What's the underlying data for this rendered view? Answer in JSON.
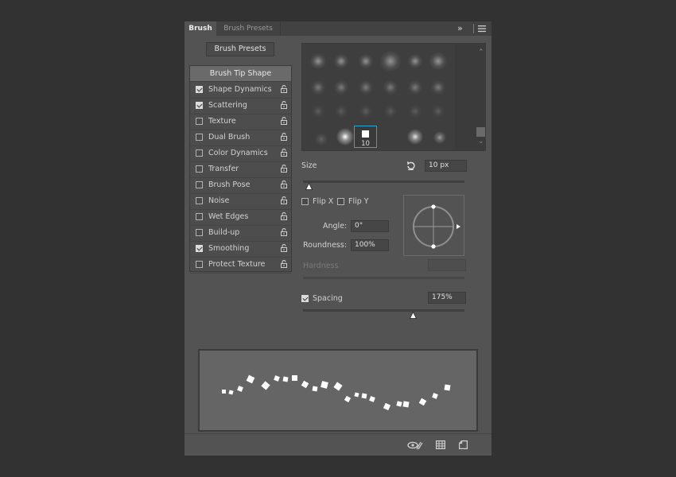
{
  "tabs": {
    "active": "Brush",
    "inactive": "Brush Presets"
  },
  "header_icons": {
    "expand": "double-chevron-right-icon",
    "menu": "hamburger-menu-icon"
  },
  "presets_button": "Brush Presets",
  "options": {
    "header": "Brush Tip Shape",
    "items": [
      {
        "label": "Shape Dynamics",
        "checked": true
      },
      {
        "label": "Scattering",
        "checked": true
      },
      {
        "label": "Texture",
        "checked": false
      },
      {
        "label": "Dual Brush",
        "checked": false
      },
      {
        "label": "Color Dynamics",
        "checked": false
      },
      {
        "label": "Transfer",
        "checked": false
      },
      {
        "label": "Brush Pose",
        "checked": false
      },
      {
        "label": "Noise",
        "checked": false
      },
      {
        "label": "Wet Edges",
        "checked": false
      },
      {
        "label": "Build-up",
        "checked": false
      },
      {
        "label": "Smoothing",
        "checked": true
      },
      {
        "label": "Protect Texture",
        "checked": false
      }
    ]
  },
  "tip_grid": {
    "selected_size": "10"
  },
  "size": {
    "label": "Size",
    "value": "10 px"
  },
  "flip": {
    "x_label": "Flip X",
    "x_checked": false,
    "y_label": "Flip Y",
    "y_checked": false
  },
  "angle": {
    "label": "Angle:",
    "value": "0°"
  },
  "roundness": {
    "label": "Roundness:",
    "value": "100%"
  },
  "hardness": {
    "label": "Hardness",
    "value": ""
  },
  "spacing": {
    "label": "Spacing",
    "checked": true,
    "value": "175%"
  },
  "bottom_icons": [
    "visibility-toggle-icon",
    "grid-icon",
    "new-preset-icon"
  ],
  "colors": {
    "panel": "#535353",
    "background": "#323232",
    "selection": "#2ea5d0"
  }
}
